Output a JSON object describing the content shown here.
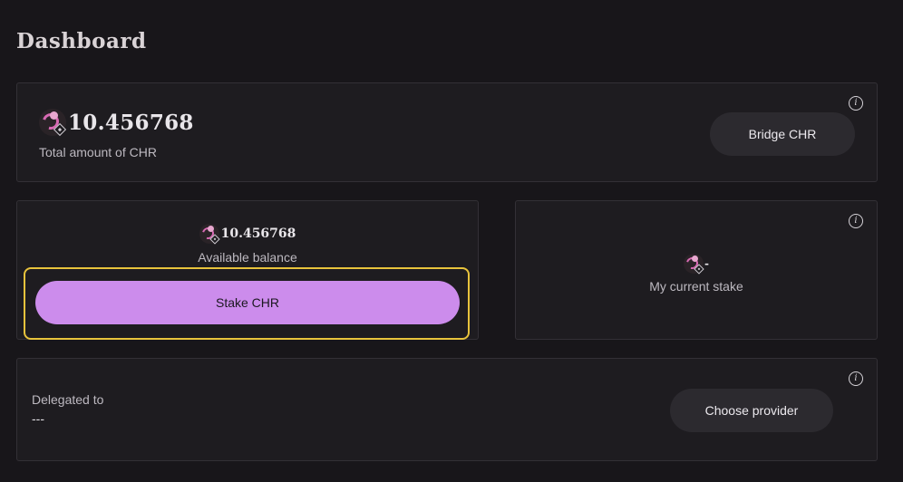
{
  "page": {
    "title": "Dashboard"
  },
  "total": {
    "amount": "10.456768",
    "label": "Total amount of CHR",
    "bridge_button": "Bridge CHR",
    "info_icon": "info-icon",
    "token_icon": "chr-bnb-token-icon"
  },
  "balance": {
    "amount": "10.456768",
    "label": "Available balance",
    "stake_button": "Stake CHR"
  },
  "stake": {
    "amount": "-",
    "label": "My current stake"
  },
  "delegated": {
    "label": "Delegated to",
    "value": "---",
    "provider_button": "Choose provider"
  },
  "colors": {
    "background": "#18161a",
    "card": "#1e1c20",
    "accent": "#cc8cec",
    "highlight": "#e8c33c"
  }
}
